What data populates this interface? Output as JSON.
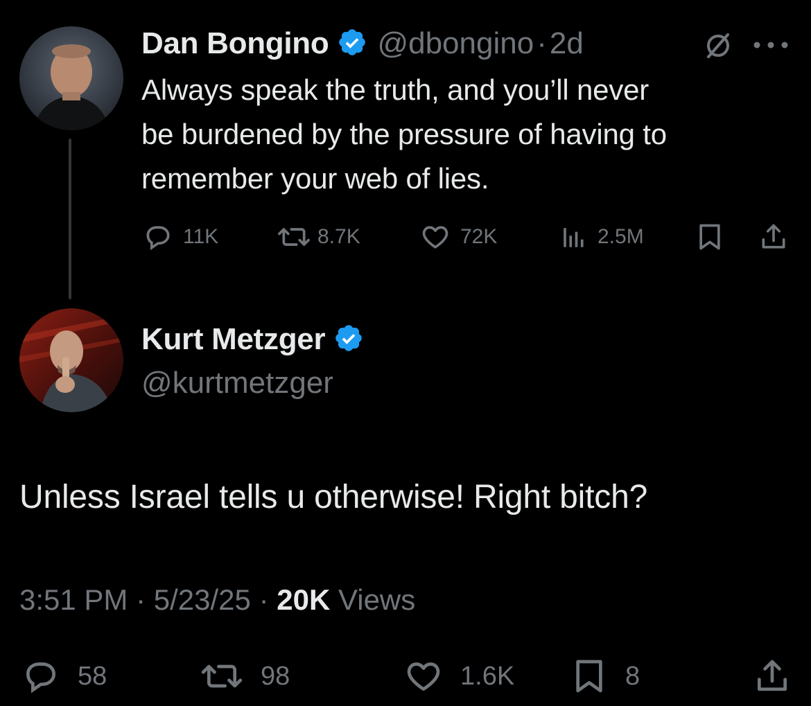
{
  "colors": {
    "background": "#000000",
    "text_primary": "#e7e9ea",
    "text_muted": "#71767b",
    "verified_blue": "#1d9bf0",
    "thread_line": "#333639"
  },
  "parent_tweet": {
    "author_name": "Dan Bongino",
    "handle": "@dbongino",
    "separator": "·",
    "time_ago": "2d",
    "verified": true,
    "grok_icon": "grok-icon",
    "more_icon": "more-icon",
    "text_lines": [
      "Always speak the truth, and you’ll never",
      "be burdened by the pressure of having to",
      "remember your web of lies."
    ],
    "metrics": {
      "replies": "11K",
      "reposts": "8.7K",
      "likes": "72K",
      "views": "2.5M"
    }
  },
  "reply_tweet": {
    "author_name": "Kurt Metzger",
    "handle": "@kurtmetzger",
    "verified": true,
    "text": "Unless Israel tells u otherwise! Right bitch?",
    "time": "3:51 PM",
    "date": "5/23/25",
    "separator": "·",
    "views_count": "20K",
    "views_label": "Views",
    "metrics": {
      "replies": "58",
      "reposts": "98",
      "likes": "1.6K",
      "bookmarks": "8"
    }
  }
}
